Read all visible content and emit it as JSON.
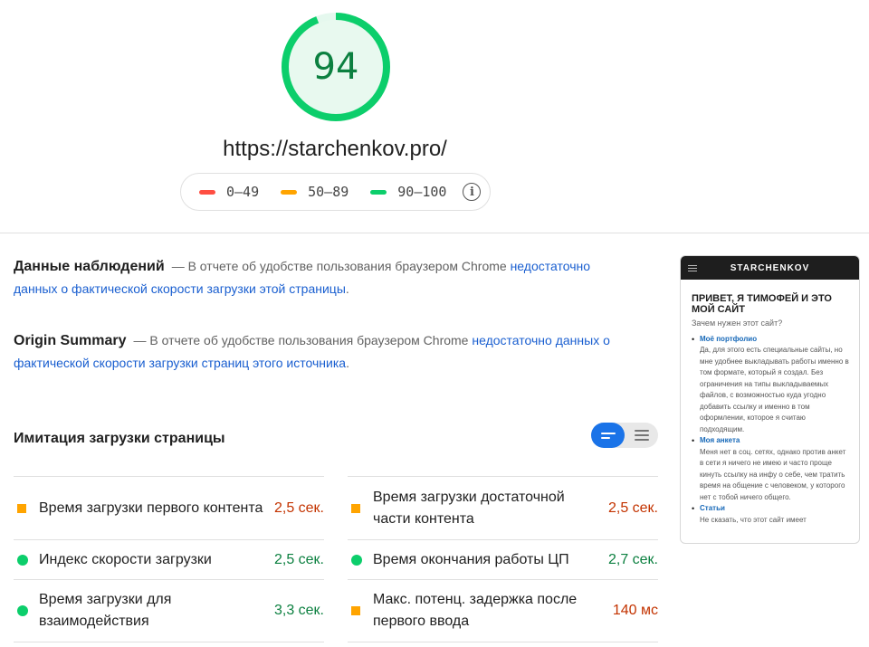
{
  "score": {
    "value": "94",
    "fraction": 0.94,
    "color": "#0cce6b",
    "track_color": "#e5f8ee"
  },
  "url": "https://starchenkov.pro/",
  "legend": {
    "items": [
      {
        "range": "0–49",
        "color": "#ff4e42"
      },
      {
        "range": "50–89",
        "color": "#ffa400"
      },
      {
        "range": "90–100",
        "color": "#0cce6b"
      }
    ],
    "info_icon": "info-icon"
  },
  "field_data": {
    "title": "Данные наблюдений",
    "text": "— В отчете об удобстве пользования браузером Chrome ",
    "link": "недостаточно данных о фактической скорости загрузки этой страницы",
    "tail": "."
  },
  "origin_summary": {
    "title": "Origin Summary",
    "text": "— В отчете об удобстве пользования браузером Chrome ",
    "link": "недостаточно данных о фактической скорости загрузки страниц этого источника",
    "tail": "."
  },
  "simulation": {
    "title": "Имитация загрузки страницы",
    "toggle": {
      "active": "compact-view",
      "inactive": "expanded-view"
    },
    "metrics_left": [
      {
        "label": "Время загрузки первого контента",
        "value": "2,5 сек.",
        "status": "average"
      },
      {
        "label": "Индекс скорости загрузки",
        "value": "2,5 сек.",
        "status": "good"
      },
      {
        "label": "Время загрузки для взаимодействия",
        "value": "3,3 сек.",
        "status": "good"
      }
    ],
    "metrics_right": [
      {
        "label": "Время загрузки достаточной части контента",
        "value": "2,5 сек.",
        "status": "average"
      },
      {
        "label": "Время окончания работы ЦП",
        "value": "2,7 сек.",
        "status": "good"
      },
      {
        "label": "Макс. потенц. задержка после первого ввода",
        "value": "140 мс",
        "status": "average"
      }
    ]
  },
  "preview": {
    "brand": "STARCHENKOV",
    "heading": "ПРИВЕТ, Я ТИМОФЕЙ И ЭТО МОЙ САЙТ",
    "subheading": "Зачем нужен этот сайт?",
    "items": [
      {
        "link": "Моё портфолио",
        "text": "Да, для этого есть специальные сайты, но мне удобнее выкладывать работы именно в том формате, который я создал. Без ограничения на типы выкладываемых файлов, с возможностью куда угодно добавить ссылку и именно в том оформлении, которое я считаю подходящим."
      },
      {
        "link": "Моя анкета",
        "text": "Меня нет в соц. сетях, однако против анкет в сети я ничего не имею и часто проще кинуть ссылку на инфу о себе, чем тратить время на общение с человеком, у которого нет с тобой ничего общего."
      },
      {
        "link": "Статьи",
        "text": "Не сказать, что этот сайт имеет"
      }
    ]
  }
}
